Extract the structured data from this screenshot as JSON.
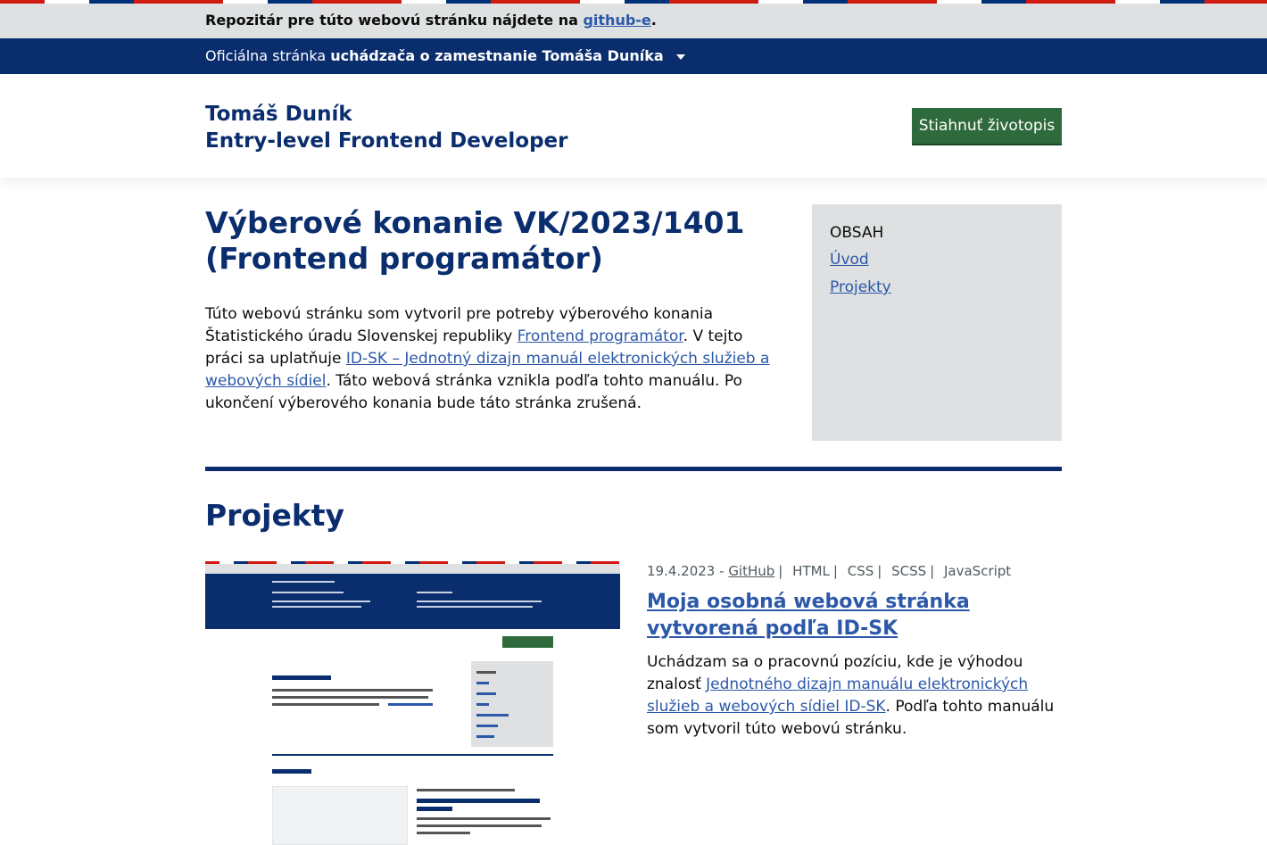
{
  "repo_banner": {
    "text_before": "Repozitár pre túto webovú stránku nájdete na ",
    "link": "github-e",
    "text_after": "."
  },
  "official_bar": {
    "prefix": "Oficiálna stránka ",
    "strong": "uchádzača o zamestnanie Tomáša Duníka"
  },
  "header": {
    "name": "Tomáš Duník",
    "role": "Entry-level Frontend Developer",
    "cv_button": "Stiahnuť životopis"
  },
  "main": {
    "title_line1": "Výberové konanie VK/2023/1401",
    "title_line2": "(Frontend programátor)",
    "intro": {
      "p1": "Túto webovú stránku som vytvoril pre potreby výberového konania Štatistického úradu Slovenskej republiky ",
      "link1": "Frontend programátor",
      "p2": ". V tejto práci sa uplatňuje ",
      "link2": "ID-SK – Jednotný dizajn manuál elektronických služieb a webových sídiel",
      "p3": ". Táto webová stránka vznikla podľa tohto manuálu. Po ukončení výberového konania bude táto stránka zrušená."
    }
  },
  "toc": {
    "heading": "OBSAH",
    "items": [
      {
        "label": "Úvod"
      },
      {
        "label": "Projekty"
      }
    ]
  },
  "projects": {
    "heading": "Projekty",
    "items": [
      {
        "date": "19.4.2023 -",
        "tags": [
          "GitHub",
          "HTML",
          "CSS",
          "SCSS",
          "JavaScript"
        ],
        "title": "Moja osobná webová stránka vytvorená podľa ID-SK",
        "desc_before": "Uchádzam sa o pracovnú pozíciu, kde je výhodou znalosť ",
        "desc_link": "Jednotného dizajn manuálu elektronických služieb a webových sídiel ID-SK",
        "desc_after": ". Podľa tohto manuálu som vytvoril túto webovú stránku."
      }
    ]
  },
  "colors": {
    "brand_blue": "#0a2d6e",
    "link_blue": "#2b58a8",
    "button_green": "#2f6a3c",
    "grey_panel": "#dee0e2"
  }
}
